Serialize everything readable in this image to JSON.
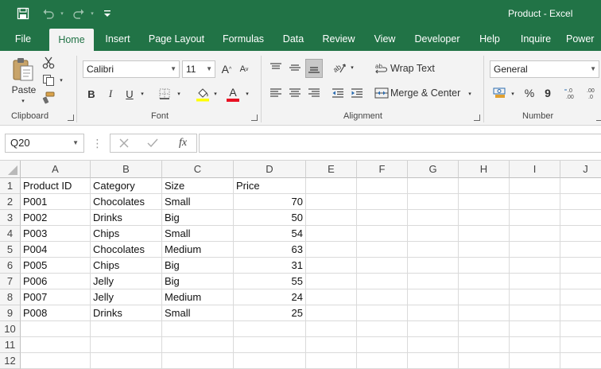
{
  "window": {
    "title": "Product  -  Excel"
  },
  "quick_access": {
    "icons": [
      "save-icon",
      "undo-icon",
      "redo-icon",
      "customize-qat-icon"
    ]
  },
  "tabs": [
    "File",
    "Home",
    "Insert",
    "Page Layout",
    "Formulas",
    "Data",
    "Review",
    "View",
    "Developer",
    "Help",
    "Inquire",
    "Power"
  ],
  "active_tab": "Home",
  "ribbon": {
    "clipboard": {
      "label": "Clipboard",
      "paste_label": "Paste"
    },
    "font": {
      "label": "Font",
      "font_name": "Calibri",
      "font_size": "11",
      "bold": "B",
      "italic": "I",
      "underline": "U",
      "grow": "A",
      "shrink": "A",
      "font_color": "A"
    },
    "alignment": {
      "label": "Alignment",
      "wrap_text": "Wrap Text",
      "merge_center": "Merge & Center"
    },
    "number": {
      "label": "Number",
      "format": "General",
      "percent": "%",
      "comma": "9"
    }
  },
  "formula_bar": {
    "name_box": "Q20",
    "fx": "fx",
    "value": ""
  },
  "sheet": {
    "columns": [
      "A",
      "B",
      "C",
      "D",
      "E",
      "F",
      "G",
      "H",
      "I",
      "J"
    ],
    "rows": [
      "1",
      "2",
      "3",
      "4",
      "5",
      "6",
      "7",
      "8",
      "9",
      "10",
      "11",
      "12"
    ],
    "header": [
      "Product ID",
      "Category",
      "Size",
      "Price"
    ],
    "data": [
      [
        "P001",
        "Chocolates",
        "Small",
        "70"
      ],
      [
        "P002",
        "Drinks",
        "Big",
        "50"
      ],
      [
        "P003",
        "Chips",
        "Small",
        "54"
      ],
      [
        "P004",
        "Chocolates",
        "Medium",
        "63"
      ],
      [
        "P005",
        "Chips",
        "Big",
        "31"
      ],
      [
        "P006",
        "Jelly",
        "Big",
        "55"
      ],
      [
        "P007",
        "Jelly",
        "Medium",
        "24"
      ],
      [
        "P008",
        "Drinks",
        "Small",
        "25"
      ]
    ]
  },
  "colors": {
    "brand": "#217346",
    "ribbon_bg": "#f3f3f3",
    "font_color_bar": "#e81123",
    "highlight_bar": "#ffff00"
  }
}
